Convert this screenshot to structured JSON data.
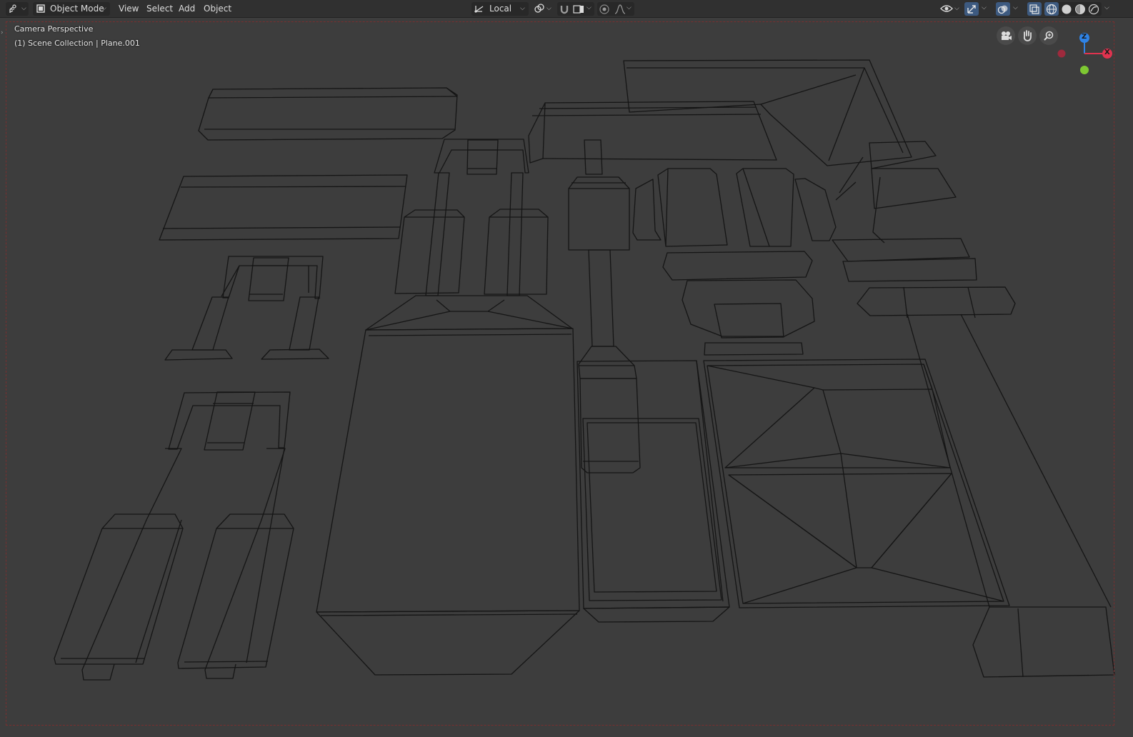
{
  "header": {
    "editor_type_icon": "editor-type-icon",
    "mode": {
      "label": "Object Mode",
      "icon": "object-mode-icon"
    },
    "menus": [
      "View",
      "Select",
      "Add",
      "Object"
    ],
    "transform_orientation": {
      "label": "Local",
      "icon": "transform-orientation-icon"
    },
    "pivot_icon": "pivot-point-icon",
    "snap_icon": "snap-magnet-icon",
    "snap_target_icon": "snap-target-icon",
    "proportional_icon": "proportional-editing-icon",
    "falloff_icon": "falloff-curve-icon",
    "visibility_icon": "object-visibility-icon",
    "gizmo_icon": "gizmo-toggle-icon",
    "overlay_icon": "overlays-icon",
    "xray_icon": "xray-toggle-icon",
    "shading_icons": [
      "wireframe-shading-icon",
      "solid-shading-icon",
      "material-preview-icon",
      "rendered-shading-icon"
    ],
    "active_shading": "wireframe",
    "accent_color": "#3d5a80"
  },
  "viewport": {
    "view_name": "Camera Perspective",
    "collection_info": "(1) Scene Collection | Plane.001",
    "background_color": "#3d3d3d",
    "wire_color": "#111111",
    "nav_buttons": [
      "camera-view-icon",
      "pan-hand-icon",
      "zoom-icon"
    ],
    "gizmo": {
      "z_label": "Z",
      "x_label": "X",
      "z_color": "#2f83e6",
      "x_color": "#e0334f",
      "y_color": "#7ec832",
      "neg_x_color": "#9e2a3d"
    }
  }
}
